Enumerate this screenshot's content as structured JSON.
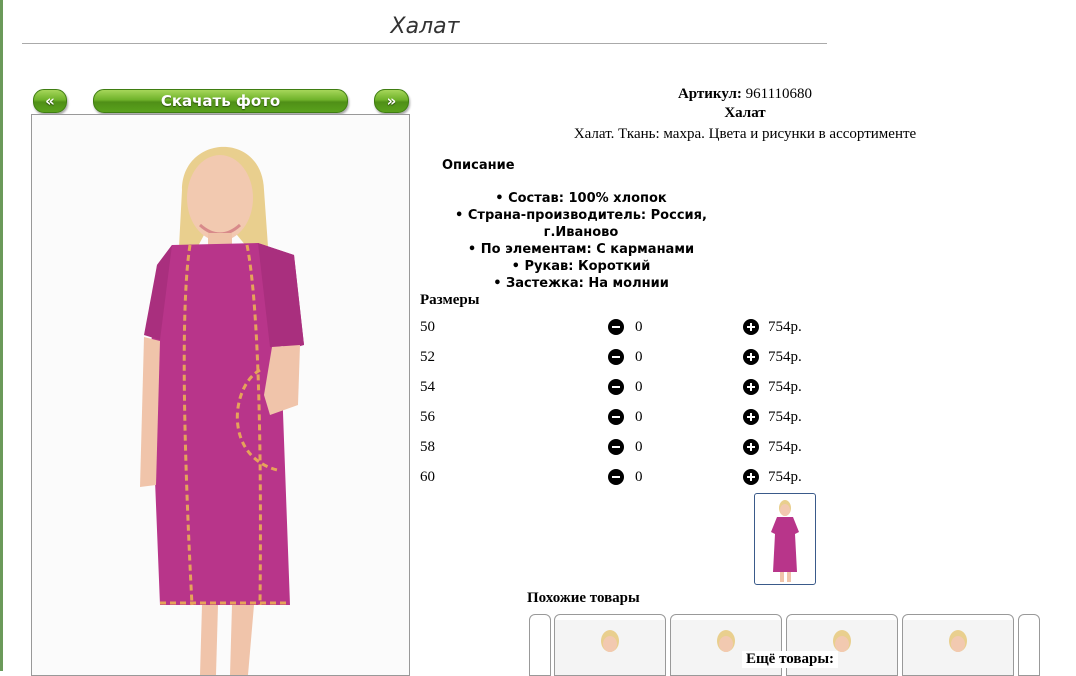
{
  "page": {
    "title": "Халат"
  },
  "photo_nav": {
    "prev_label": "«",
    "download_label": "Скачать фото",
    "next_label": "»"
  },
  "product": {
    "sku_label": "Артикул:",
    "sku_value": "961110680",
    "name": "Халат",
    "short_description": "Халат. Ткань: махра. Цвета и рисунки в ассортименте",
    "description_heading": "Описание",
    "features": [
      "Состав: 100% хлопок",
      "Страна-производитель: Россия, г.Иваново",
      "По элементам: С карманами",
      "Рукав: Короткий",
      "Застежка: На молнии"
    ]
  },
  "sizes": {
    "heading": "Размеры",
    "rows": [
      {
        "size": "50",
        "qty": "0",
        "price": "754р."
      },
      {
        "size": "52",
        "qty": "0",
        "price": "754р."
      },
      {
        "size": "54",
        "qty": "0",
        "price": "754р."
      },
      {
        "size": "56",
        "qty": "0",
        "price": "754р."
      },
      {
        "size": "58",
        "qty": "0",
        "price": "754р."
      },
      {
        "size": "60",
        "qty": "0",
        "price": "754р."
      }
    ]
  },
  "similar": {
    "heading": "Похожие товары"
  },
  "more": {
    "heading": "Ещё товары:"
  },
  "icons": {
    "minus": "minus-circle-icon",
    "plus": "plus-circle-icon"
  },
  "colors": {
    "button_green": "#6fb22a",
    "robe_magenta": "#b8358a",
    "thumb_border": "#3a5a8a"
  }
}
